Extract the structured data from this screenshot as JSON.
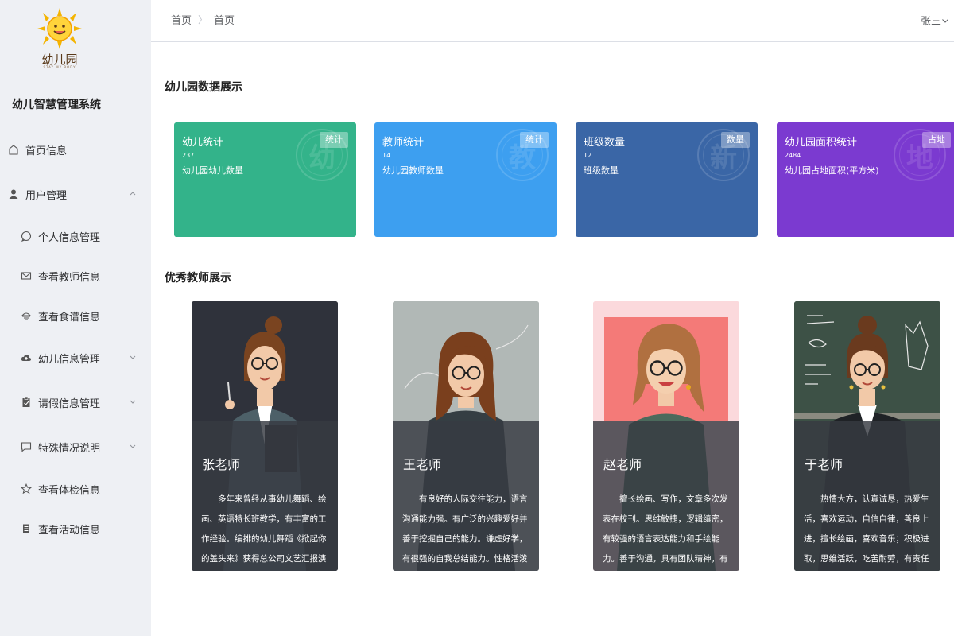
{
  "sidebar": {
    "logo_text": "幼儿园",
    "logo_subtext": "STAY MY BODY",
    "system_title": "幼儿智慧管理系统",
    "items": [
      {
        "label": "首页信息",
        "icon": "home-icon"
      },
      {
        "label": "用户管理",
        "icon": "user-icon",
        "expanded": true
      },
      {
        "label": "个人信息管理",
        "icon": "chat-bubble-icon"
      },
      {
        "label": "查看教师信息",
        "icon": "mail-icon"
      },
      {
        "label": "查看食谱信息",
        "icon": "dish-icon"
      },
      {
        "label": "幼儿信息管理",
        "icon": "upload-cloud-icon"
      },
      {
        "label": "请假信息管理",
        "icon": "clipboard-icon"
      },
      {
        "label": "特殊情况说明",
        "icon": "message-icon"
      },
      {
        "label": "查看体检信息",
        "icon": "star-icon"
      },
      {
        "label": "查看活动信息",
        "icon": "document-icon"
      }
    ]
  },
  "header": {
    "breadcrumb": [
      "首页",
      "首页"
    ],
    "user": "张三"
  },
  "stats_section": {
    "title": "幼儿园数据展示",
    "cards": [
      {
        "title": "幼儿统计",
        "value": "237",
        "desc": "幼儿园幼儿数量",
        "badge": "统计",
        "watermark": "幼",
        "color": "#33b38a"
      },
      {
        "title": "教师统计",
        "value": "14",
        "desc": "幼儿园教师数量",
        "badge": "统计",
        "watermark": "教",
        "color": "#3d9ff0"
      },
      {
        "title": "班级数量",
        "value": "12",
        "desc": "班级数量",
        "badge": "数量",
        "watermark": "新",
        "color": "#3a66a6"
      },
      {
        "title": "幼儿园面积统计",
        "value": "2484",
        "desc": "幼儿园占地面积(平方米)",
        "badge": "占地",
        "watermark": "地",
        "color": "#7b3ad0"
      }
    ]
  },
  "teachers_section": {
    "title": "优秀教师展示",
    "cards": [
      {
        "name": "张老师",
        "desc": "多年来曾经从事幼儿舞蹈、绘画、英语特长班教学，有丰富的工作经验。编排的幼儿舞蹈《掀起你的盖头来》获得总公司文艺汇报演出二等奖。"
      },
      {
        "name": "王老师",
        "desc": "有良好的人际交往能力，语言沟通能力强。有广泛的兴趣爱好并善于挖掘自己的能力。谦虚好学，有很强的自我总结能力。性格活泼开朗，善于与人交流。"
      },
      {
        "name": "赵老师",
        "desc": "擅长绘画、写作，文章多次发表在校刊。思维敏捷，逻辑缜密，有较强的语言表达能力和手绘能力。善于沟通，具有团队精神，有毅力，不惧困难。"
      },
      {
        "name": "于老师",
        "desc": "热情大方，认真诚恳，热爱生活，喜欢运动，自信自律，善良上进，擅长绘画，喜欢音乐；积极进取，思维活跃，吃苦耐劳，有责任心。"
      }
    ]
  }
}
